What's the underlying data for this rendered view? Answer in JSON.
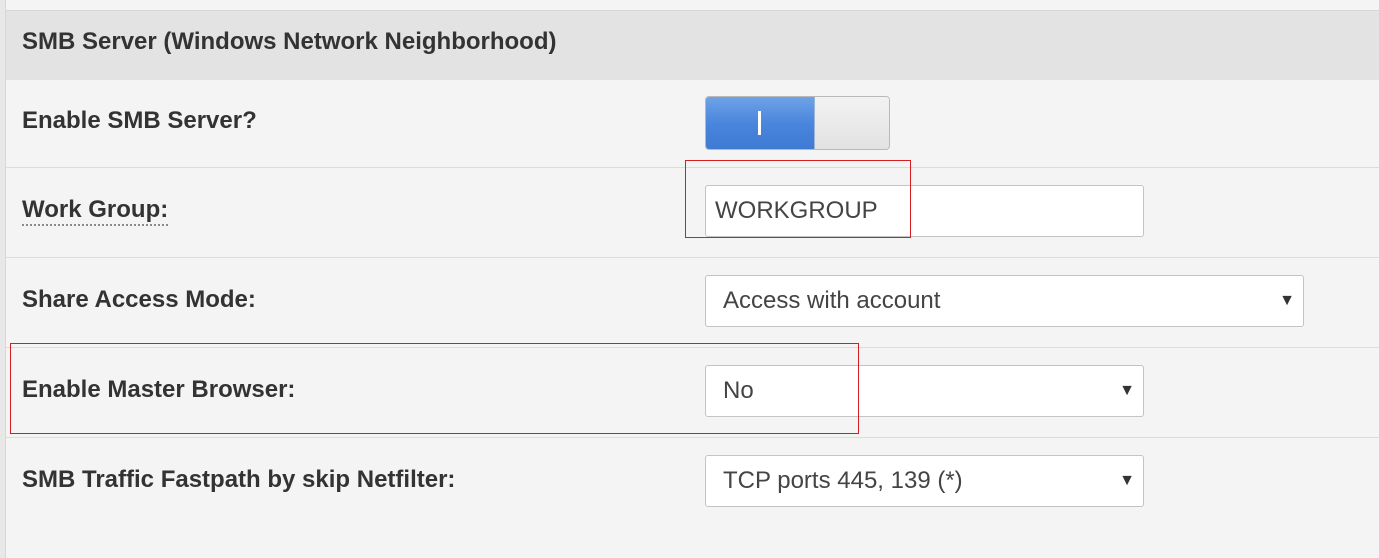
{
  "section": {
    "title": "SMB Server (Windows Network Neighborhood)"
  },
  "settings": {
    "enable_smb": {
      "label": "Enable SMB Server?",
      "toggle_on_symbol": "I",
      "state": "on"
    },
    "work_group": {
      "label": "Work Group:",
      "value": "WORKGROUP"
    },
    "share_access_mode": {
      "label": "Share Access Mode:",
      "value": "Access with account"
    },
    "master_browser": {
      "label": "Enable Master Browser:",
      "value": "No"
    },
    "fastpath": {
      "label": "SMB Traffic Fastpath by skip Netfilter:",
      "value": "TCP ports 445, 139 (*)"
    }
  },
  "icons": {
    "dropdown": "triangle-down"
  },
  "colors": {
    "toggle_on": "#4a86dc",
    "highlight_box": "#d71c24",
    "header_bg": "#e3e3e3"
  }
}
